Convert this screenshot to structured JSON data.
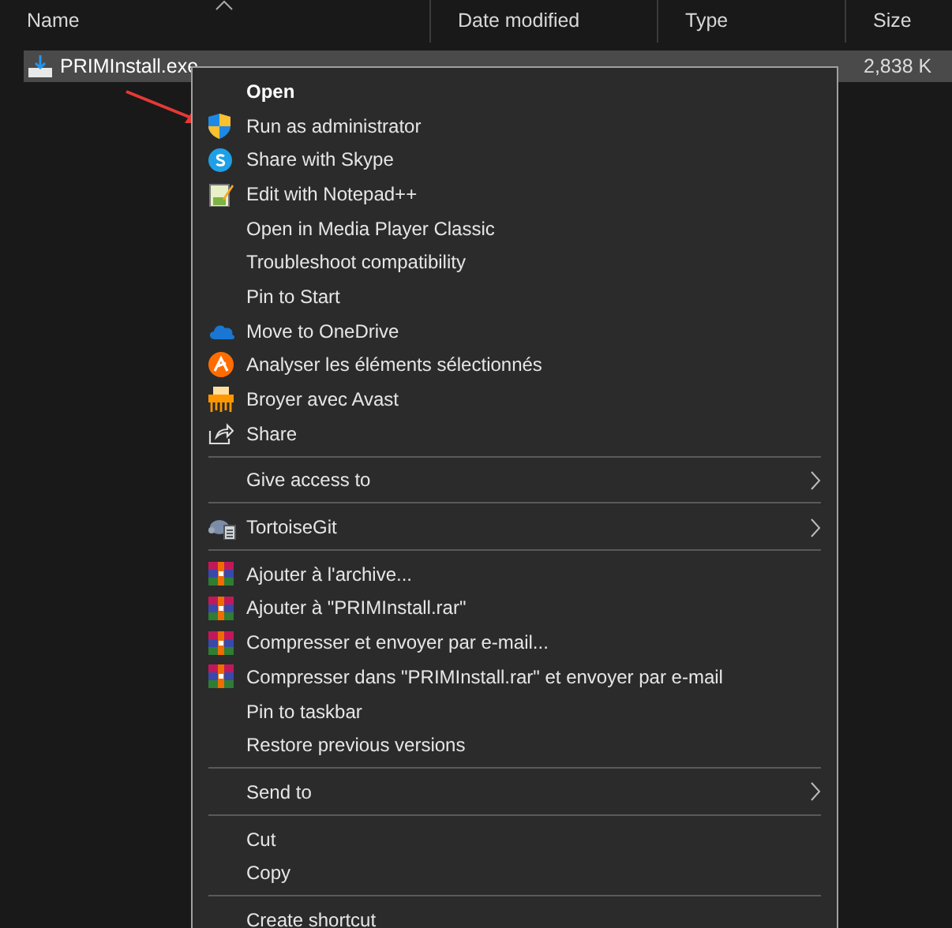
{
  "columns": [
    {
      "label": "Name",
      "sorted": true
    },
    {
      "label": "Date modified"
    },
    {
      "label": "Type"
    },
    {
      "label": "Size"
    }
  ],
  "file": {
    "name": "PRIMInstall.exe",
    "size": "2,838 K",
    "selected": true
  },
  "menu": [
    {
      "kind": "item",
      "label": "Open",
      "bold": true
    },
    {
      "kind": "item",
      "label": "Run as administrator"
    },
    {
      "kind": "item",
      "label": "Share with Skype"
    },
    {
      "kind": "item",
      "label": "Edit with Notepad++"
    },
    {
      "kind": "item",
      "label": "Open in Media Player Classic"
    },
    {
      "kind": "item",
      "label": "Troubleshoot compatibility"
    },
    {
      "kind": "item",
      "label": "Pin to Start"
    },
    {
      "kind": "item",
      "label": "Move to OneDrive"
    },
    {
      "kind": "item",
      "label": "Analyser les éléments sélectionnés"
    },
    {
      "kind": "item",
      "label": "Broyer avec Avast"
    },
    {
      "kind": "item",
      "label": "Share"
    },
    {
      "kind": "separator"
    },
    {
      "kind": "submenu",
      "label": "Give access to"
    },
    {
      "kind": "separator"
    },
    {
      "kind": "submenu",
      "label": "TortoiseGit"
    },
    {
      "kind": "separator"
    },
    {
      "kind": "item",
      "label": "Ajouter à l'archive..."
    },
    {
      "kind": "item",
      "label": "Ajouter à \"PRIMInstall.rar\""
    },
    {
      "kind": "item",
      "label": "Compresser et envoyer par e-mail..."
    },
    {
      "kind": "item",
      "label": "Compresser dans \"PRIMInstall.rar\" et envoyer par e-mail"
    },
    {
      "kind": "item",
      "label": "Pin to taskbar"
    },
    {
      "kind": "item",
      "label": "Restore previous versions"
    },
    {
      "kind": "separator"
    },
    {
      "kind": "submenu",
      "label": "Send to"
    },
    {
      "kind": "separator"
    },
    {
      "kind": "item",
      "label": "Cut"
    },
    {
      "kind": "item",
      "label": "Copy"
    },
    {
      "kind": "separator"
    },
    {
      "kind": "item",
      "label": "Create shortcut"
    }
  ]
}
